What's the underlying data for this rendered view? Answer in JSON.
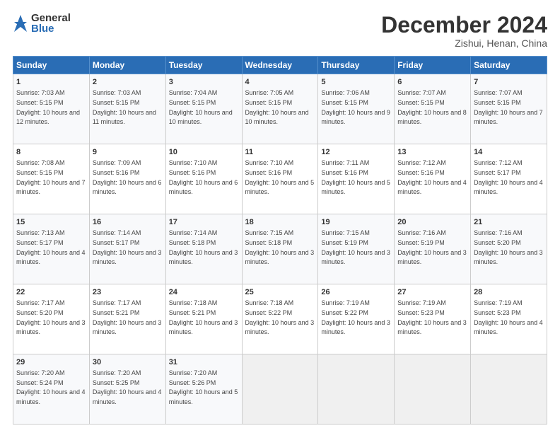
{
  "header": {
    "logo_general": "General",
    "logo_blue": "Blue",
    "month_title": "December 2024",
    "location": "Zishui, Henan, China"
  },
  "days_of_week": [
    "Sunday",
    "Monday",
    "Tuesday",
    "Wednesday",
    "Thursday",
    "Friday",
    "Saturday"
  ],
  "weeks": [
    [
      {
        "num": "1",
        "sr": "7:03 AM",
        "ss": "5:15 PM",
        "dl": "10 hours and 12 minutes."
      },
      {
        "num": "2",
        "sr": "7:03 AM",
        "ss": "5:15 PM",
        "dl": "10 hours and 11 minutes."
      },
      {
        "num": "3",
        "sr": "7:04 AM",
        "ss": "5:15 PM",
        "dl": "10 hours and 10 minutes."
      },
      {
        "num": "4",
        "sr": "7:05 AM",
        "ss": "5:15 PM",
        "dl": "10 hours and 10 minutes."
      },
      {
        "num": "5",
        "sr": "7:06 AM",
        "ss": "5:15 PM",
        "dl": "10 hours and 9 minutes."
      },
      {
        "num": "6",
        "sr": "7:07 AM",
        "ss": "5:15 PM",
        "dl": "10 hours and 8 minutes."
      },
      {
        "num": "7",
        "sr": "7:07 AM",
        "ss": "5:15 PM",
        "dl": "10 hours and 7 minutes."
      }
    ],
    [
      {
        "num": "8",
        "sr": "7:08 AM",
        "ss": "5:15 PM",
        "dl": "10 hours and 7 minutes."
      },
      {
        "num": "9",
        "sr": "7:09 AM",
        "ss": "5:16 PM",
        "dl": "10 hours and 6 minutes."
      },
      {
        "num": "10",
        "sr": "7:10 AM",
        "ss": "5:16 PM",
        "dl": "10 hours and 6 minutes."
      },
      {
        "num": "11",
        "sr": "7:10 AM",
        "ss": "5:16 PM",
        "dl": "10 hours and 5 minutes."
      },
      {
        "num": "12",
        "sr": "7:11 AM",
        "ss": "5:16 PM",
        "dl": "10 hours and 5 minutes."
      },
      {
        "num": "13",
        "sr": "7:12 AM",
        "ss": "5:16 PM",
        "dl": "10 hours and 4 minutes."
      },
      {
        "num": "14",
        "sr": "7:12 AM",
        "ss": "5:17 PM",
        "dl": "10 hours and 4 minutes."
      }
    ],
    [
      {
        "num": "15",
        "sr": "7:13 AM",
        "ss": "5:17 PM",
        "dl": "10 hours and 4 minutes."
      },
      {
        "num": "16",
        "sr": "7:14 AM",
        "ss": "5:17 PM",
        "dl": "10 hours and 3 minutes."
      },
      {
        "num": "17",
        "sr": "7:14 AM",
        "ss": "5:18 PM",
        "dl": "10 hours and 3 minutes."
      },
      {
        "num": "18",
        "sr": "7:15 AM",
        "ss": "5:18 PM",
        "dl": "10 hours and 3 minutes."
      },
      {
        "num": "19",
        "sr": "7:15 AM",
        "ss": "5:19 PM",
        "dl": "10 hours and 3 minutes."
      },
      {
        "num": "20",
        "sr": "7:16 AM",
        "ss": "5:19 PM",
        "dl": "10 hours and 3 minutes."
      },
      {
        "num": "21",
        "sr": "7:16 AM",
        "ss": "5:20 PM",
        "dl": "10 hours and 3 minutes."
      }
    ],
    [
      {
        "num": "22",
        "sr": "7:17 AM",
        "ss": "5:20 PM",
        "dl": "10 hours and 3 minutes."
      },
      {
        "num": "23",
        "sr": "7:17 AM",
        "ss": "5:21 PM",
        "dl": "10 hours and 3 minutes."
      },
      {
        "num": "24",
        "sr": "7:18 AM",
        "ss": "5:21 PM",
        "dl": "10 hours and 3 minutes."
      },
      {
        "num": "25",
        "sr": "7:18 AM",
        "ss": "5:22 PM",
        "dl": "10 hours and 3 minutes."
      },
      {
        "num": "26",
        "sr": "7:19 AM",
        "ss": "5:22 PM",
        "dl": "10 hours and 3 minutes."
      },
      {
        "num": "27",
        "sr": "7:19 AM",
        "ss": "5:23 PM",
        "dl": "10 hours and 3 minutes."
      },
      {
        "num": "28",
        "sr": "7:19 AM",
        "ss": "5:23 PM",
        "dl": "10 hours and 4 minutes."
      }
    ],
    [
      {
        "num": "29",
        "sr": "7:20 AM",
        "ss": "5:24 PM",
        "dl": "10 hours and 4 minutes."
      },
      {
        "num": "30",
        "sr": "7:20 AM",
        "ss": "5:25 PM",
        "dl": "10 hours and 4 minutes."
      },
      {
        "num": "31",
        "sr": "7:20 AM",
        "ss": "5:26 PM",
        "dl": "10 hours and 5 minutes."
      },
      null,
      null,
      null,
      null
    ]
  ]
}
